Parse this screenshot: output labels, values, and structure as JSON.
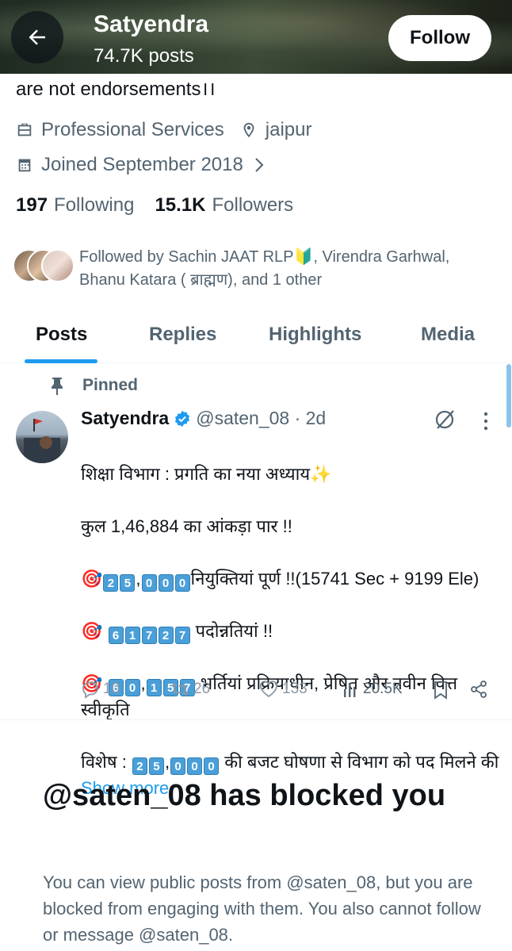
{
  "header": {
    "name": "Satyendra",
    "posts_count": "74.7K posts",
    "follow_label": "Follow"
  },
  "profile": {
    "bio_tail": "are not endorsements।।",
    "category": "Professional Services",
    "location": "jaipur",
    "joined": "Joined September 2018",
    "following_count": "197",
    "following_label": "Following",
    "followers_count": "15.1K",
    "followers_label": "Followers",
    "followed_by": "Followed by Sachin JAAT RLP🔰, Virendra Garhwal, Bhanu Katara ( ब्राह्मण), and 1 other"
  },
  "tabs": [
    {
      "label": "Posts",
      "active": true
    },
    {
      "label": "Replies",
      "active": false
    },
    {
      "label": "Highlights",
      "active": false
    },
    {
      "label": "Media",
      "active": false
    }
  ],
  "pinned_post": {
    "pinned_label": "Pinned",
    "author": "Satyendra",
    "handle": "@saten_08 · 2d",
    "line1": "शिक्षा विभाग : प्रगति का नया अध्याय✨",
    "line2": "कुल 1,46,884 का आंकड़ा पार !!",
    "line3_digits": [
      "2",
      "5",
      ",",
      "0",
      "0",
      "0"
    ],
    "line3_text": "नियुक्तियां पूर्ण !!(15741 Sec + 9199 Ele)",
    "line4_digits": [
      "6",
      "1",
      "7",
      "2",
      "7"
    ],
    "line4_text": " पदोन्नतियां !!",
    "line5_digits": [
      "6",
      "0",
      ",",
      "1",
      "5",
      "7"
    ],
    "line5_text": " भर्तियां प्रक्रियाधीन, प्रेषित और नवीन वित्त स्वीकृति",
    "line6_prefix": "विशेष : ",
    "line6_digits": [
      "2",
      "5",
      ",",
      "0",
      "0",
      "0"
    ],
    "line6_text": " की बजट घोषणा से विभाग को पद मिलने की ",
    "show_more": "Show more",
    "replies": "10",
    "reposts": "26",
    "likes": "133",
    "views": "20.5K"
  },
  "blocked": {
    "title": "@saten_08 has blocked you",
    "text": "You can view public posts from @saten_08, but you are blocked from engaging with them. You also cannot follow or message @saten_08."
  },
  "colors": {
    "accent": "#1d9bf0",
    "secondary_text": "#536471",
    "primary_text": "#0f1419"
  }
}
